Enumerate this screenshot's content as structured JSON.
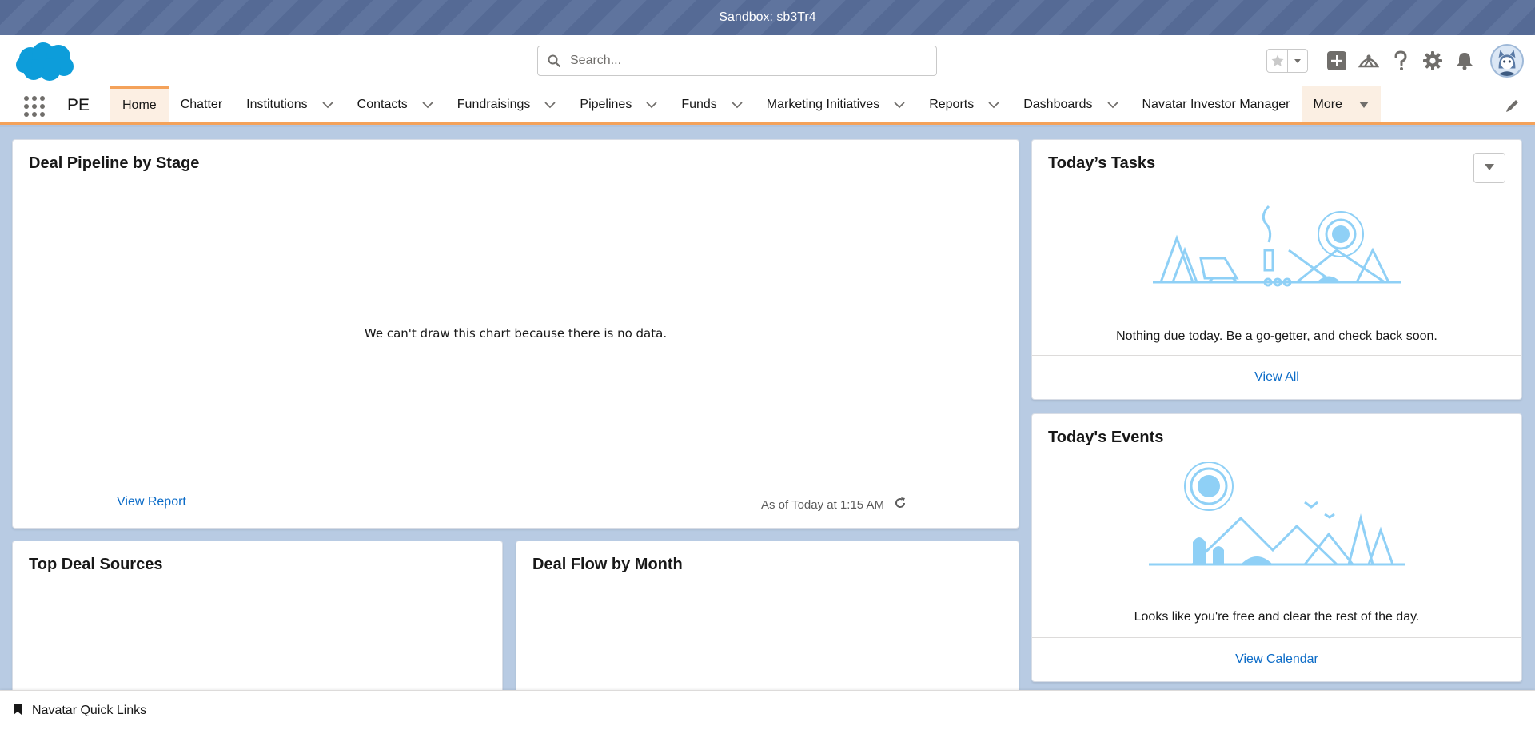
{
  "sandbox": {
    "label": "Sandbox: sb3Tr4"
  },
  "header": {
    "search_placeholder": "Search...",
    "icons": [
      "star-icon",
      "chevron-down-icon",
      "add-icon",
      "trailhead-icon",
      "help-icon",
      "setup-gear-icon",
      "notification-bell-icon",
      "avatar"
    ]
  },
  "nav": {
    "app_name": "PE",
    "items": [
      {
        "label": "Home",
        "active": true,
        "has_menu": false
      },
      {
        "label": "Chatter",
        "has_menu": false
      },
      {
        "label": "Institutions",
        "has_menu": true
      },
      {
        "label": "Contacts",
        "has_menu": true
      },
      {
        "label": "Fundraisings",
        "has_menu": true
      },
      {
        "label": "Pipelines",
        "has_menu": true
      },
      {
        "label": "Funds",
        "has_menu": true
      },
      {
        "label": "Marketing Initiatives",
        "has_menu": true
      },
      {
        "label": "Reports",
        "has_menu": true
      },
      {
        "label": "Dashboards",
        "has_menu": true
      },
      {
        "label": "Navatar Investor Manager",
        "has_menu": false
      }
    ],
    "more_label": "More"
  },
  "pipeline_card": {
    "title": "Deal Pipeline by Stage",
    "no_data": "We can't draw this chart because there is no data.",
    "view_report": "View Report",
    "as_of": "As of Today at 1:15 AM"
  },
  "deal_sources_card": {
    "title": "Top Deal Sources"
  },
  "deal_flow_card": {
    "title": "Deal Flow by Month"
  },
  "tasks_card": {
    "title": "Today’s Tasks",
    "message": "Nothing due today. Be a go-getter, and check back soon.",
    "footer_link": "View All"
  },
  "events_card": {
    "title": "Today's Events",
    "message": "Looks like you're free and clear the rest of the day.",
    "footer_link": "View Calendar"
  },
  "utility_bar": {
    "quick_links": "Navatar Quick Links"
  },
  "colors": {
    "accent": "#0b6bc7",
    "nav_active": "#f4a25a",
    "sandbox_bar": "#556a95",
    "illustration": "#8fd0f6"
  }
}
